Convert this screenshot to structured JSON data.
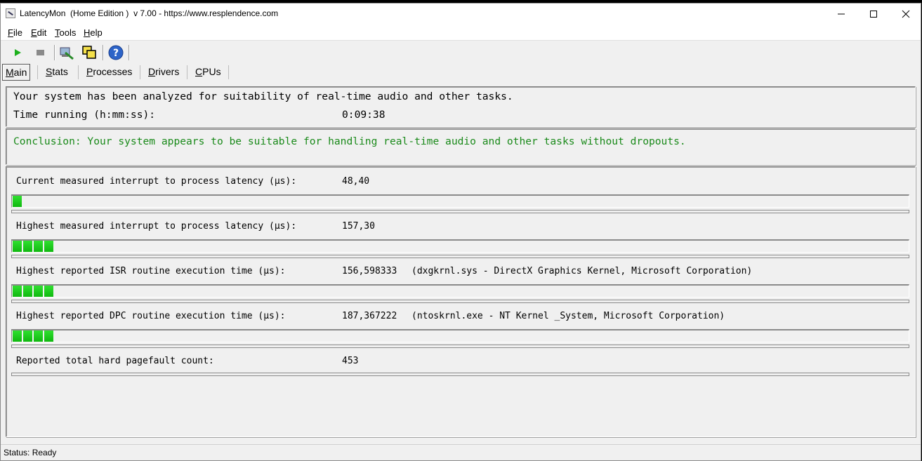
{
  "window": {
    "title": "LatencyMon  (Home Edition )  v 7.00 - https://www.resplendence.com",
    "controls": [
      "minimize-icon",
      "maximize-icon",
      "close-icon"
    ]
  },
  "menu": [
    {
      "label": "File",
      "mnemonic": "F",
      "rest": "ile"
    },
    {
      "label": "Edit",
      "mnemonic": "E",
      "rest": "dit"
    },
    {
      "label": "Tools",
      "mnemonic": "T",
      "rest": "ools"
    },
    {
      "label": "Help",
      "mnemonic": "H",
      "rest": "elp"
    }
  ],
  "toolbar": {
    "icons": [
      "play-icon",
      "stop-icon",
      "analyze-icon",
      "windows-icon",
      "help-icon"
    ]
  },
  "tabs": [
    {
      "m": "M",
      "rest": "ain",
      "active": true
    },
    {
      "m": "S",
      "rest": "tats",
      "active": false
    },
    {
      "m": "P",
      "rest": "rocesses",
      "active": false
    },
    {
      "m": "D",
      "rest": "rivers",
      "active": false
    },
    {
      "m": "C",
      "rest": "PUs",
      "active": false
    }
  ],
  "summary": {
    "line1": "Your system has been analyzed for suitability of real-time audio and other tasks.",
    "time_label": "Time running (h:mm:ss):",
    "time_value": "0:09:38"
  },
  "conclusion": "Conclusion: Your system appears to be suitable for handling real-time audio and other tasks without dropouts.",
  "metrics": [
    {
      "label": "Current measured interrupt to process latency (µs):",
      "value": "48,40",
      "detail": "",
      "blocks": 1
    },
    {
      "label": "Highest measured interrupt to process latency (µs):",
      "value": "157,30",
      "detail": "",
      "blocks": 4
    },
    {
      "label": "Highest reported ISR routine execution time (µs):",
      "value": "156,598333",
      "detail": "(dxgkrnl.sys - DirectX Graphics Kernel, Microsoft Corporation)",
      "blocks": 4
    },
    {
      "label": "Highest reported DPC routine execution time (µs):",
      "value": "187,367222",
      "detail": "(ntoskrnl.exe - NT Kernel _System, Microsoft Corporation)",
      "blocks": 4
    },
    {
      "label": "Reported total hard pagefault count:",
      "value": "453",
      "detail": "",
      "blocks": 0
    }
  ],
  "status": "Status: Ready",
  "colors": {
    "bar_green": "#20d020",
    "conclusion_green": "#1a8a1a"
  }
}
